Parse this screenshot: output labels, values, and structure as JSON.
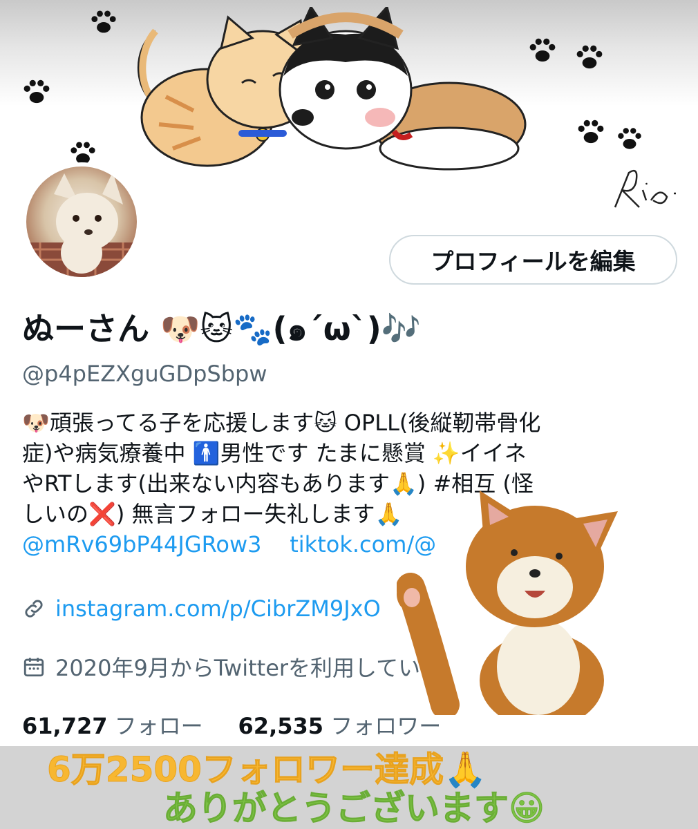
{
  "profile": {
    "display_name": "ぬーさん 🐶🐱🐾(๑´ω`)🎶",
    "handle": "@p4pEZXguGDpSbpw",
    "edit_button_label": "プロフィールを編集",
    "bio_lines": [
      "🐶頑張ってる子を応援します🐱 OPLL(後縦靭帯骨化",
      "症)や病気療養中 🚹男性です たまに懸賞 ✨イイネ",
      "やRTします(出来ない内容もあります🙏) #相互 (怪",
      "しいの❌) 無言フォロー失礼します🙏"
    ],
    "bio_hashtag": "#相互",
    "linked_account": "@mRv69bP44JGRow3",
    "tiktok_link": "tiktok.com/@",
    "website": "instagram.com/p/CibrZM9JxO",
    "joined": "2020年9月からTwitterを利用していま",
    "following_count": "61,727",
    "following_label": "フォロー",
    "followers_count": "62,535",
    "followers_label": "フォロワー"
  },
  "banner": {
    "signature": "Rio."
  },
  "overlay": {
    "line1": "6万2500フォロワー達成🙏",
    "line2": "ありがとうございます😀"
  },
  "icons": [
    "paw-icon",
    "link-icon",
    "calendar-icon"
  ],
  "colors": {
    "link": "#1d9bf0",
    "secondary_text": "#536471",
    "overlay_line1": "#f7b731",
    "overlay_line2": "#7cc244"
  }
}
